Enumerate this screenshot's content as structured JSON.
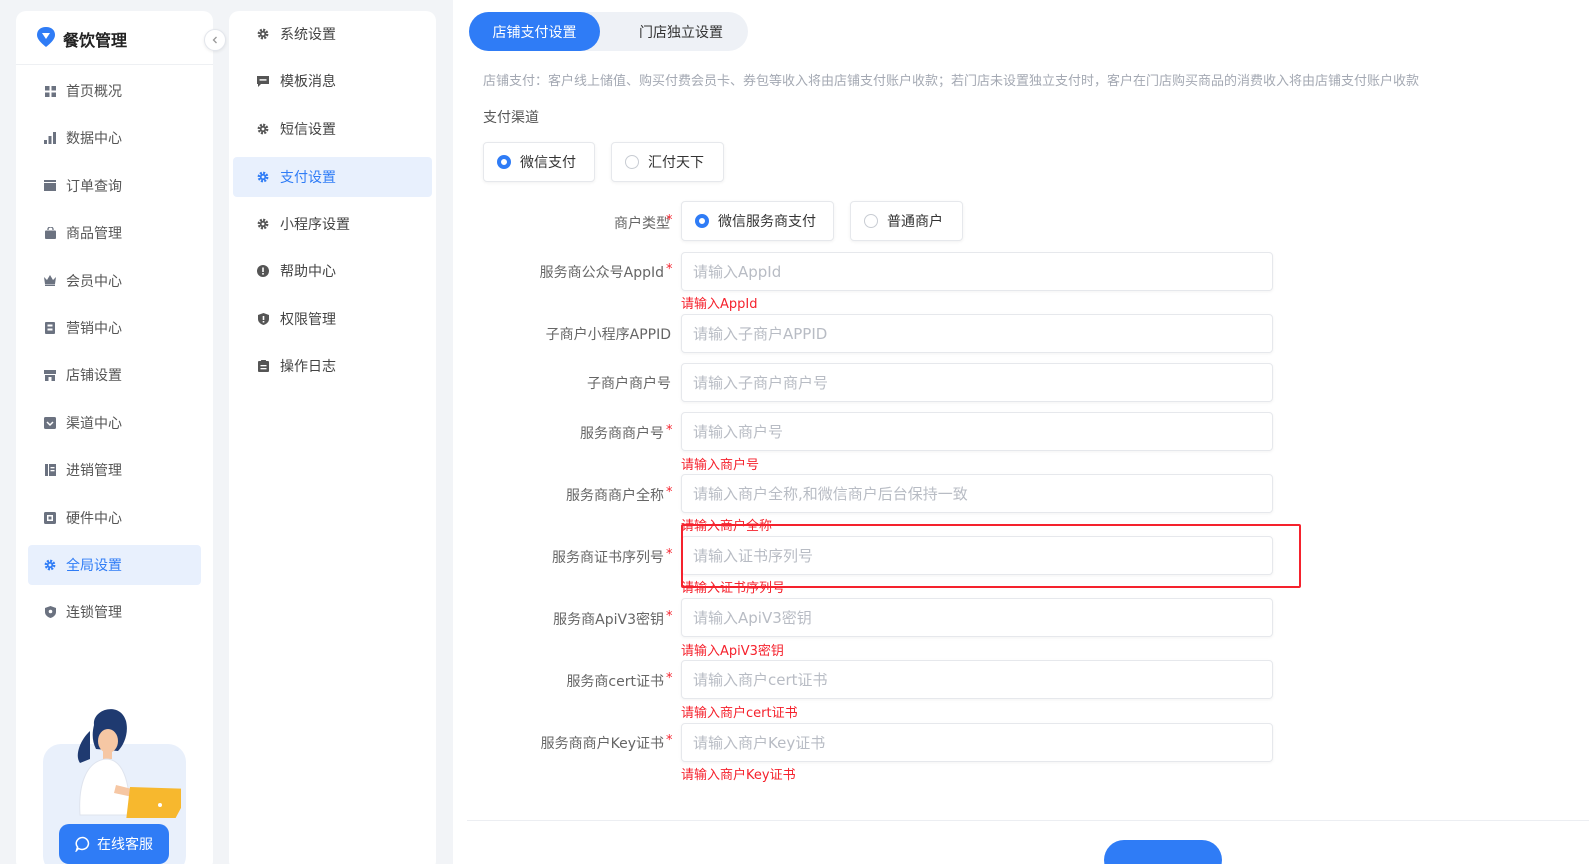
{
  "app": {
    "title": "餐饮管理"
  },
  "sidebar": {
    "items": [
      {
        "label": "首页概况",
        "icon": "grid-icon"
      },
      {
        "label": "数据中心",
        "icon": "bar-chart-icon"
      },
      {
        "label": "订单查询",
        "icon": "order-icon"
      },
      {
        "label": "商品管理",
        "icon": "bag-icon"
      },
      {
        "label": "会员中心",
        "icon": "crown-icon"
      },
      {
        "label": "营销中心",
        "icon": "marketing-icon"
      },
      {
        "label": "店铺设置",
        "icon": "store-icon"
      },
      {
        "label": "渠道中心",
        "icon": "channel-icon"
      },
      {
        "label": "进销管理",
        "icon": "inventory-icon"
      },
      {
        "label": "硬件中心",
        "icon": "hardware-icon"
      },
      {
        "label": "全局设置",
        "icon": "gear-icon",
        "active": true
      },
      {
        "label": "连锁管理",
        "icon": "chain-icon"
      }
    ],
    "service_button": "在线客服"
  },
  "submenu": {
    "items": [
      {
        "label": "系统设置",
        "icon": "gear-icon"
      },
      {
        "label": "模板消息",
        "icon": "message-icon"
      },
      {
        "label": "短信设置",
        "icon": "gear-icon"
      },
      {
        "label": "支付设置",
        "icon": "gear-icon",
        "active": true
      },
      {
        "label": "小程序设置",
        "icon": "gear-icon"
      },
      {
        "label": "帮助中心",
        "icon": "help-icon"
      },
      {
        "label": "权限管理",
        "icon": "shield-icon"
      },
      {
        "label": "操作日志",
        "icon": "log-icon"
      }
    ]
  },
  "tabs": [
    {
      "label": "店铺支付设置",
      "active": true
    },
    {
      "label": "门店独立设置",
      "active": false
    }
  ],
  "description": "店铺支付：客户线上储值、购买付费会员卡、券包等收入将由店铺支付账户收款；若门店未设置独立支付时，客户在门店购买商品的消费收入将由店铺支付账户收款",
  "payment_channel": {
    "label": "支付渠道",
    "options": [
      {
        "label": "微信支付",
        "selected": true
      },
      {
        "label": "汇付天下",
        "selected": false
      }
    ]
  },
  "merchant_type": {
    "label": "商户类型",
    "required": "*",
    "options": [
      {
        "label": "微信服务商支付",
        "selected": true
      },
      {
        "label": "普通商户",
        "selected": false
      }
    ]
  },
  "form": {
    "fields": [
      {
        "label": "服务商公众号AppId",
        "required": "*",
        "placeholder": "请输入AppId",
        "error": "请输入AppId"
      },
      {
        "label": "子商户小程序APPID",
        "required": "",
        "placeholder": "请输入子商户APPID",
        "error": ""
      },
      {
        "label": "子商户商户号",
        "required": "",
        "placeholder": "请输入子商户商户号",
        "error": ""
      },
      {
        "label": "服务商商户号",
        "required": "*",
        "placeholder": "请输入商户号",
        "error": "请输入商户号"
      },
      {
        "label": "服务商商户全称",
        "required": "*",
        "placeholder": "请输入商户全称,和微信商户后台保持一致",
        "error": "请输入商户全称"
      },
      {
        "label": "服务商证书序列号",
        "required": "*",
        "placeholder": "请输入证书序列号",
        "error": "请输入证书序列号"
      },
      {
        "label": "服务商ApiV3密钥",
        "required": "*",
        "placeholder": "请输入ApiV3密钥",
        "error": "请输入ApiV3密钥"
      },
      {
        "label": "服务商cert证书",
        "required": "*",
        "placeholder": "请输入商户cert证书",
        "error": "请输入商户cert证书"
      },
      {
        "label": "服务商商户Key证书",
        "required": "*",
        "placeholder": "请输入商户Key证书",
        "error": "请输入商户Key证书"
      }
    ]
  },
  "colors": {
    "accent": "#2f7cf6",
    "error": "#f5222d",
    "highlight_border": "#f5222d"
  }
}
